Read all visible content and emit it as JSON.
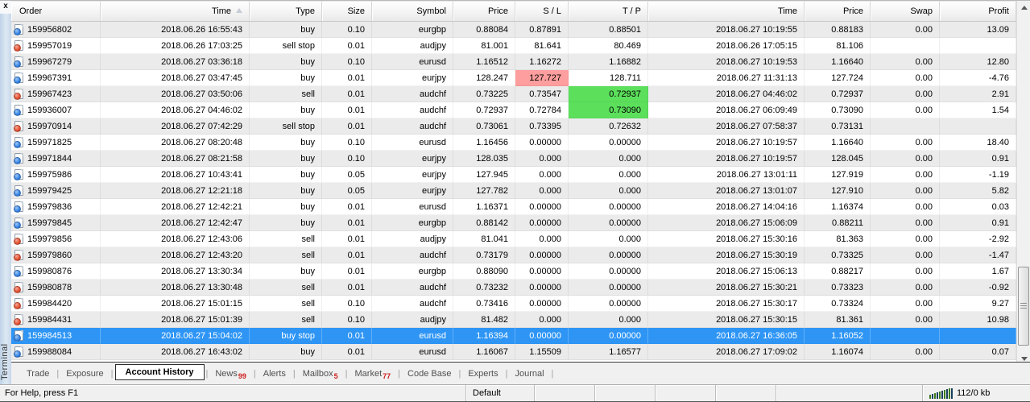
{
  "panel": {
    "title": "Terminal",
    "close_glyph": "x"
  },
  "table": {
    "columns": [
      {
        "label": "Order",
        "align": "left"
      },
      {
        "label": "Time",
        "align": "right",
        "sorted": true
      },
      {
        "label": "Type",
        "align": "right"
      },
      {
        "label": "Size",
        "align": "right"
      },
      {
        "label": "Symbol",
        "align": "right"
      },
      {
        "label": "Price",
        "align": "right"
      },
      {
        "label": "S / L",
        "align": "right"
      },
      {
        "label": "T / P",
        "align": "right"
      },
      {
        "label": "Time",
        "align": "right"
      },
      {
        "label": "Price",
        "align": "right"
      },
      {
        "label": "Swap",
        "align": "right"
      },
      {
        "label": "Profit",
        "align": "right"
      }
    ],
    "rows": [
      {
        "order": "159956802",
        "time": "2018.06.26 16:55:43",
        "type": "buy",
        "size": "0.10",
        "symbol": "eurgbp",
        "price": "0.88084",
        "sl": "0.87891",
        "tp": "0.88501",
        "close_time": "2018.06.27 10:19:55",
        "close_price": "0.88183",
        "swap": "0.00",
        "profit": "13.09",
        "icon": "buy"
      },
      {
        "order": "159957019",
        "time": "2018.06.26 17:03:25",
        "type": "sell stop",
        "size": "0.01",
        "symbol": "audjpy",
        "price": "81.001",
        "sl": "81.641",
        "tp": "80.469",
        "close_time": "2018.06.26 17:05:15",
        "close_price": "81.106",
        "swap": "",
        "profit": "",
        "icon": "sell"
      },
      {
        "order": "159967279",
        "time": "2018.06.27 03:36:18",
        "type": "buy",
        "size": "0.10",
        "symbol": "eurusd",
        "price": "1.16512",
        "sl": "1.16272",
        "tp": "1.16882",
        "close_time": "2018.06.27 10:19:53",
        "close_price": "1.16640",
        "swap": "0.00",
        "profit": "12.80",
        "icon": "buy"
      },
      {
        "order": "159967391",
        "time": "2018.06.27 03:47:45",
        "type": "buy",
        "size": "0.01",
        "symbol": "eurjpy",
        "price": "128.247",
        "sl": "127.727",
        "tp": "128.711",
        "close_time": "2018.06.27 11:31:13",
        "close_price": "127.724",
        "swap": "0.00",
        "profit": "-4.76",
        "icon": "buy",
        "sl_highlight": "pink"
      },
      {
        "order": "159967423",
        "time": "2018.06.27 03:50:06",
        "type": "sell",
        "size": "0.01",
        "symbol": "audchf",
        "price": "0.73225",
        "sl": "0.73547",
        "tp": "0.72937",
        "close_time": "2018.06.27 04:46:02",
        "close_price": "0.72937",
        "swap": "0.00",
        "profit": "2.91",
        "icon": "sell",
        "tp_highlight": "green"
      },
      {
        "order": "159936007",
        "time": "2018.06.27 04:46:02",
        "type": "buy",
        "size": "0.01",
        "symbol": "audchf",
        "price": "0.72937",
        "sl": "0.72784",
        "tp": "0.73090",
        "close_time": "2018.06.27 06:09:49",
        "close_price": "0.73090",
        "swap": "0.00",
        "profit": "1.54",
        "icon": "buy",
        "tp_highlight": "green"
      },
      {
        "order": "159970914",
        "time": "2018.06.27 07:42:29",
        "type": "sell stop",
        "size": "0.01",
        "symbol": "audchf",
        "price": "0.73061",
        "sl": "0.73395",
        "tp": "0.72632",
        "close_time": "2018.06.27 07:58:37",
        "close_price": "0.73131",
        "swap": "",
        "profit": "",
        "icon": "sell"
      },
      {
        "order": "159971825",
        "time": "2018.06.27 08:20:48",
        "type": "buy",
        "size": "0.10",
        "symbol": "eurusd",
        "price": "1.16456",
        "sl": "0.00000",
        "tp": "0.00000",
        "close_time": "2018.06.27 10:19:57",
        "close_price": "1.16640",
        "swap": "0.00",
        "profit": "18.40",
        "icon": "buy"
      },
      {
        "order": "159971844",
        "time": "2018.06.27 08:21:58",
        "type": "buy",
        "size": "0.10",
        "symbol": "eurjpy",
        "price": "128.035",
        "sl": "0.000",
        "tp": "0.000",
        "close_time": "2018.06.27 10:19:57",
        "close_price": "128.045",
        "swap": "0.00",
        "profit": "0.91",
        "icon": "buy"
      },
      {
        "order": "159975986",
        "time": "2018.06.27 10:43:41",
        "type": "buy",
        "size": "0.05",
        "symbol": "eurjpy",
        "price": "127.945",
        "sl": "0.000",
        "tp": "0.000",
        "close_time": "2018.06.27 13:01:11",
        "close_price": "127.919",
        "swap": "0.00",
        "profit": "-1.19",
        "icon": "buy"
      },
      {
        "order": "159979425",
        "time": "2018.06.27 12:21:18",
        "type": "buy",
        "size": "0.05",
        "symbol": "eurjpy",
        "price": "127.782",
        "sl": "0.000",
        "tp": "0.000",
        "close_time": "2018.06.27 13:01:07",
        "close_price": "127.910",
        "swap": "0.00",
        "profit": "5.82",
        "icon": "buy"
      },
      {
        "order": "159979836",
        "time": "2018.06.27 12:42:21",
        "type": "buy",
        "size": "0.01",
        "symbol": "eurusd",
        "price": "1.16371",
        "sl": "0.00000",
        "tp": "0.00000",
        "close_time": "2018.06.27 14:04:16",
        "close_price": "1.16374",
        "swap": "0.00",
        "profit": "0.03",
        "icon": "buy"
      },
      {
        "order": "159979845",
        "time": "2018.06.27 12:42:47",
        "type": "buy",
        "size": "0.01",
        "symbol": "eurgbp",
        "price": "0.88142",
        "sl": "0.00000",
        "tp": "0.00000",
        "close_time": "2018.06.27 15:06:09",
        "close_price": "0.88211",
        "swap": "0.00",
        "profit": "0.91",
        "icon": "buy"
      },
      {
        "order": "159979856",
        "time": "2018.06.27 12:43:06",
        "type": "sell",
        "size": "0.01",
        "symbol": "audjpy",
        "price": "81.041",
        "sl": "0.000",
        "tp": "0.000",
        "close_time": "2018.06.27 15:30:16",
        "close_price": "81.363",
        "swap": "0.00",
        "profit": "-2.92",
        "icon": "sell"
      },
      {
        "order": "159979860",
        "time": "2018.06.27 12:43:20",
        "type": "sell",
        "size": "0.01",
        "symbol": "audchf",
        "price": "0.73179",
        "sl": "0.00000",
        "tp": "0.00000",
        "close_time": "2018.06.27 15:30:19",
        "close_price": "0.73325",
        "swap": "0.00",
        "profit": "-1.47",
        "icon": "sell"
      },
      {
        "order": "159980876",
        "time": "2018.06.27 13:30:34",
        "type": "buy",
        "size": "0.01",
        "symbol": "eurgbp",
        "price": "0.88090",
        "sl": "0.00000",
        "tp": "0.00000",
        "close_time": "2018.06.27 15:06:13",
        "close_price": "0.88217",
        "swap": "0.00",
        "profit": "1.67",
        "icon": "buy"
      },
      {
        "order": "159980878",
        "time": "2018.06.27 13:30:48",
        "type": "sell",
        "size": "0.01",
        "symbol": "audchf",
        "price": "0.73232",
        "sl": "0.00000",
        "tp": "0.00000",
        "close_time": "2018.06.27 15:30:21",
        "close_price": "0.73323",
        "swap": "0.00",
        "profit": "-0.92",
        "icon": "sell"
      },
      {
        "order": "159984420",
        "time": "2018.06.27 15:01:15",
        "type": "sell",
        "size": "0.10",
        "symbol": "audchf",
        "price": "0.73416",
        "sl": "0.00000",
        "tp": "0.00000",
        "close_time": "2018.06.27 15:30:17",
        "close_price": "0.73324",
        "swap": "0.00",
        "profit": "9.27",
        "icon": "sell"
      },
      {
        "order": "159984431",
        "time": "2018.06.27 15:01:39",
        "type": "sell",
        "size": "0.10",
        "symbol": "audjpy",
        "price": "81.482",
        "sl": "0.000",
        "tp": "0.000",
        "close_time": "2018.06.27 15:30:15",
        "close_price": "81.361",
        "swap": "0.00",
        "profit": "10.98",
        "icon": "sell"
      },
      {
        "order": "159984513",
        "time": "2018.06.27 15:04:02",
        "type": "buy stop",
        "size": "0.01",
        "symbol": "eurusd",
        "price": "1.16394",
        "sl": "0.00000",
        "tp": "0.00000",
        "close_time": "2018.06.27 16:36:05",
        "close_price": "1.16052",
        "swap": "",
        "profit": "",
        "icon": "buy",
        "selected": true
      },
      {
        "order": "159988084",
        "time": "2018.06.27 16:43:02",
        "type": "buy",
        "size": "0.01",
        "symbol": "eurusd",
        "price": "1.16067",
        "sl": "1.15509",
        "tp": "1.16577",
        "close_time": "2018.06.27 17:09:02",
        "close_price": "1.16074",
        "swap": "0.00",
        "profit": "0.07",
        "icon": "buy"
      }
    ]
  },
  "tabs": [
    {
      "label": "Trade"
    },
    {
      "label": "Exposure"
    },
    {
      "label": "Account History",
      "active": true
    },
    {
      "label": "News",
      "badge": "99"
    },
    {
      "label": "Alerts"
    },
    {
      "label": "Mailbox",
      "badge": "5"
    },
    {
      "label": "Market",
      "badge": "77"
    },
    {
      "label": "Code Base"
    },
    {
      "label": "Experts"
    },
    {
      "label": "Journal"
    }
  ],
  "status_bar": {
    "help_text": "For Help, press F1",
    "profile": "Default",
    "connection": "112/0 kb"
  },
  "colors": {
    "selected_row": "#2e95f5",
    "sl_hit": "#ff9e9e",
    "tp_hit": "#5ce05c",
    "badge_red": "#d02020",
    "alt_row": "#ebebeb"
  }
}
